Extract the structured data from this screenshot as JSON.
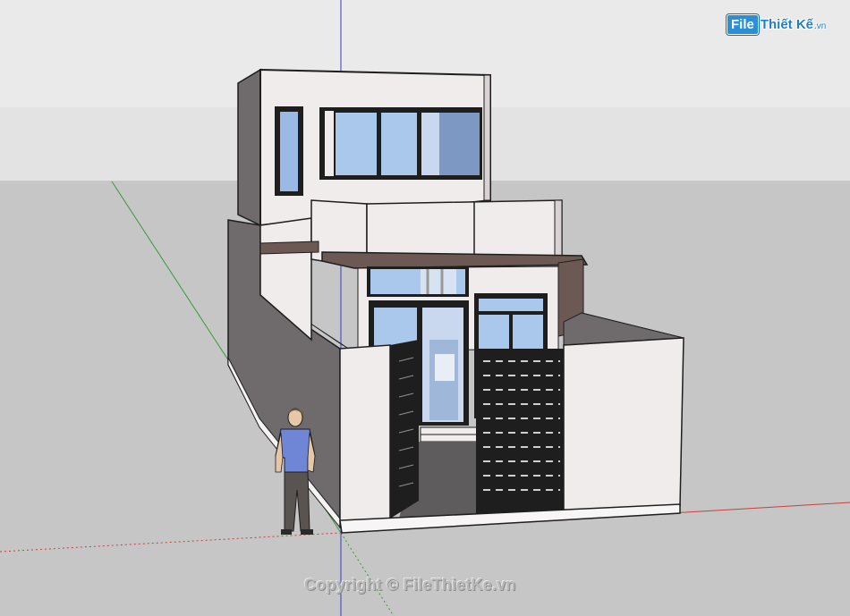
{
  "watermark": {
    "logo_file": "File",
    "logo_name": "Thiết Kế",
    "logo_tld": ".vn",
    "copyright": "Copyright © FileThietKe.vn"
  },
  "colors": {
    "sky": "#dedede",
    "ground": "#c6c6c6",
    "wall_light": "#f1ecec",
    "wall_shadow": "#6f6b6c",
    "glass": "#a9c8ec",
    "frame": "#1e1e1e",
    "canopy": "#5a4a46",
    "axis_red": "#c84040",
    "axis_green": "#3a9a3a",
    "axis_blue": "#3a3acc"
  },
  "scene": {
    "subject": "two-storey townhouse model",
    "figure": "scale person",
    "gate_icon": "sliding-gate-icon"
  }
}
